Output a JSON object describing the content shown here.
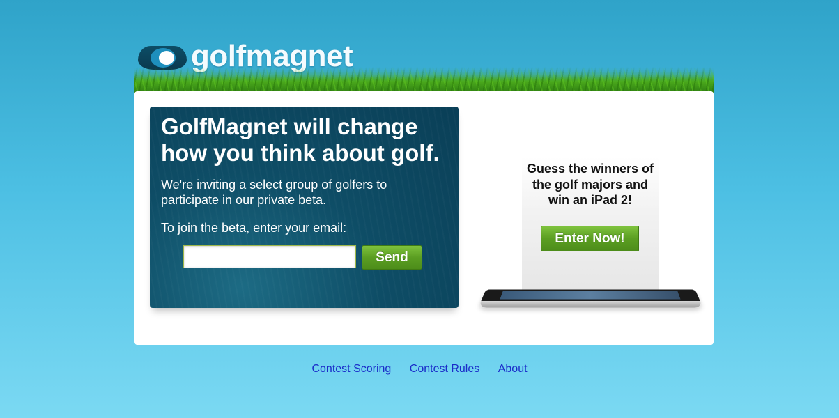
{
  "brand": {
    "logo_text": "golfmagnet",
    "logo_icon": "golf-ball-magnet-icon"
  },
  "promo": {
    "headline": "GolfMagnet will change how you think about golf.",
    "invite_text": "We're inviting a select group of golfers to participate in our private beta.",
    "join_prompt": "To join the beta, enter your email:",
    "email_value": "",
    "email_placeholder": "",
    "send_label": "Send"
  },
  "contest": {
    "text": "Guess the winners of the golf majors and win an iPad 2!",
    "enter_label": "Enter Now!",
    "device_icon": "tablet-device-icon"
  },
  "footer": {
    "links": [
      "Contest Scoring",
      "Contest Rules",
      "About"
    ]
  },
  "colors": {
    "background_top": "#2fa3c9",
    "background_bottom": "#7bd9f3",
    "promo_panel": "#0e4d66",
    "button_green": "#5b9e22",
    "link_blue": "#1a2cc9"
  }
}
